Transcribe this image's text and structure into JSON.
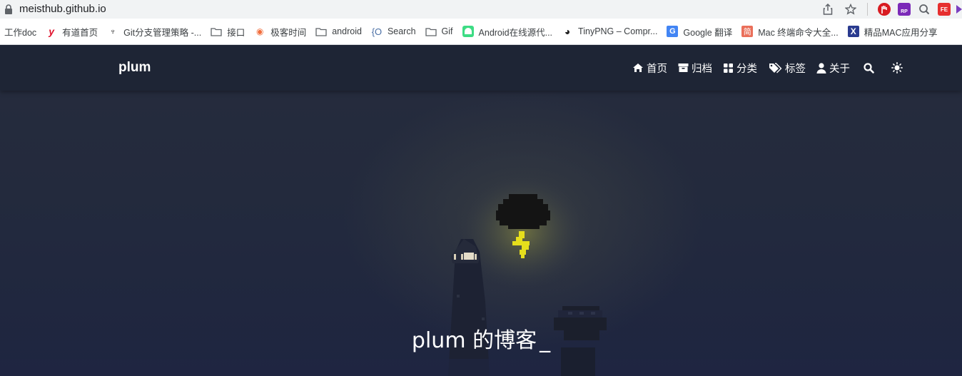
{
  "browser": {
    "url": "meisthub.github.io",
    "extension_badges": [
      "RP",
      "FE"
    ]
  },
  "bookmarks": [
    {
      "label": "工作doc",
      "icon": "none"
    },
    {
      "label": "有道首页",
      "icon": "youdao-icon",
      "glyph": "y",
      "color": "#e0112b"
    },
    {
      "label": "Git分支管理策略 -...",
      "icon": "brush-icon",
      "glyph": "♆",
      "color": "#333333"
    },
    {
      "label": "接口",
      "icon": "folder-icon"
    },
    {
      "label": "极客时间",
      "icon": "geektime-icon",
      "glyph": "◉",
      "color": "#f16d3c"
    },
    {
      "label": "android",
      "icon": "folder-icon"
    },
    {
      "label": "Search",
      "icon": "search-site-icon",
      "glyph": "{O",
      "color": "#4a6fa5"
    },
    {
      "label": "Gif",
      "icon": "folder-icon"
    },
    {
      "label": "Android在线源代...",
      "icon": "android-icon",
      "glyph": "■",
      "color": "#3ddc84"
    },
    {
      "label": "TinyPNG – Compr...",
      "icon": "panda-icon",
      "glyph": "◕",
      "color": "#222222"
    },
    {
      "label": "Google 翻译",
      "icon": "google-translate-icon",
      "glyph": "G",
      "color": "#4285f4"
    },
    {
      "label": "Mac 终端命令大全...",
      "icon": "jianshu-icon",
      "glyph": "简",
      "color": "#ea6f5a"
    },
    {
      "label": "精品MAC应用分享",
      "icon": "x-app-icon",
      "glyph": "X",
      "color": "#2a3b8f"
    }
  ],
  "site": {
    "brand": "plum",
    "nav": [
      {
        "label": "首页",
        "icon": "home-icon"
      },
      {
        "label": "归档",
        "icon": "archive-icon"
      },
      {
        "label": "分类",
        "icon": "category-icon"
      },
      {
        "label": "标签",
        "icon": "tags-icon"
      },
      {
        "label": "关于",
        "icon": "user-icon"
      }
    ],
    "search_icon": "search-icon",
    "theme_icon": "sun-icon",
    "hero_title": "plum 的博客",
    "hero_cursor": "_"
  }
}
